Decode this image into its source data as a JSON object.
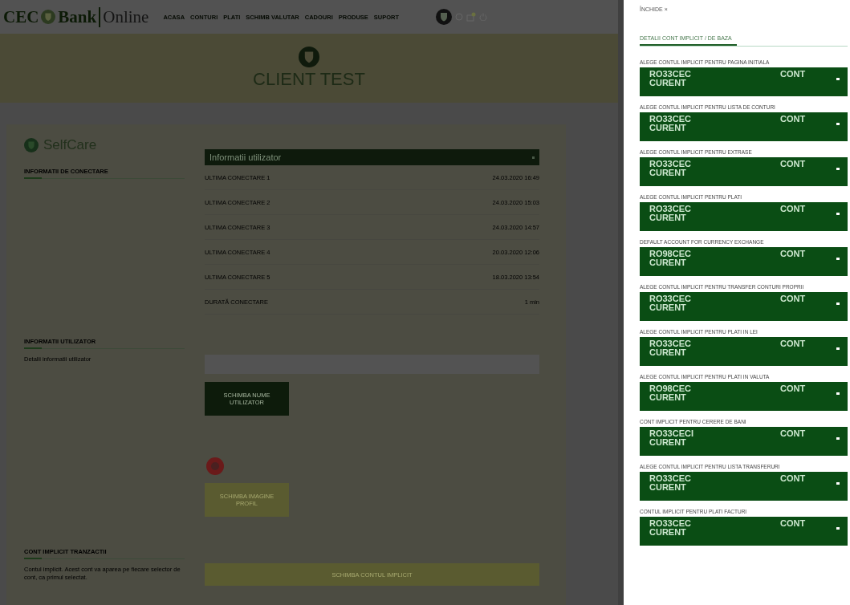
{
  "nav": {
    "logo": {
      "left": "CEC",
      "middle": "Bank",
      "right": "Online"
    },
    "items": [
      "ACASA",
      "CONTURI",
      "PLATI",
      "SCHIMB VALUTAR",
      "CADOURI",
      "PRODUSE",
      "SUPORT"
    ]
  },
  "header": {
    "client_name": "CLIENT TEST"
  },
  "selfcare": {
    "title": "SelfCare",
    "sections": [
      {
        "title": "INFORMATII DE CONECTARE"
      },
      {
        "title": "INFORMATII UTILIZATOR",
        "text": "Detalii informatii utilizator"
      },
      {
        "title": "CONT IMPLICIT TRANZACTII",
        "text": "Contul implicit. Acest cont va aparea pe fiecare selector de cont, ca primul selectat."
      }
    ],
    "dropdown": {
      "value": "Informatii utilizator"
    },
    "rows": [
      {
        "label": "ULTIMA CONECTARE 1",
        "value": "24.03.2020 16:49"
      },
      {
        "label": "ULTIMA CONECTARE 2",
        "value": "24.03.2020 15:03"
      },
      {
        "label": "ULTIMA CONECTARE 3",
        "value": "24.03.2020 14:57"
      },
      {
        "label": "ULTIMA CONECTARE 4",
        "value": "20.03.2020 12:06"
      },
      {
        "label": "ULTIMA CONECTARE 5",
        "value": "18.03.2020 13:54"
      },
      {
        "label": "DURATĂ CONECTARE",
        "value": "1 min"
      }
    ],
    "buttons": [
      {
        "label": "SCHIMBA NUME UTILIZATOR",
        "disabled": false
      },
      {
        "label": "SCHIMBA IMAGINE PROFIL",
        "disabled": true
      },
      {
        "label": "SCHIMBA CONTUL IMPLICIT",
        "disabled": true
      }
    ]
  },
  "drawer": {
    "close": "ÎNCHIDE ×",
    "tabs": [
      {
        "label": "DETALII CONT IMPLICIT / DE BAZA",
        "selected": true
      }
    ],
    "selects": [
      {
        "label": "ALEGE CONTUL IMPLICIT PENTRU PAGINA INITIALA",
        "account": "RO33CEC",
        "type": "CURENT",
        "kind_label": "CONT"
      },
      {
        "label": "ALEGE CONTUL IMPLICIT PENTRU LISTA DE CONTURI",
        "account": "RO33CEC",
        "type": "CURENT",
        "kind_label": "CONT"
      },
      {
        "label": "ALEGE CONTUL IMPLICIT PENTRU EXTRASE",
        "account": "RO33CEC",
        "type": "CURENT",
        "kind_label": "CONT"
      },
      {
        "label": "ALEGE CONTUL IMPLICIT PENTRU PLATI",
        "account": "RO33CEC",
        "type": "CURENT",
        "kind_label": "CONT"
      },
      {
        "label": "DEFAULT ACCOUNT FOR CURRENCY EXCHANGE",
        "account": "RO98CEC",
        "type": "CURENT",
        "kind_label": "CONT"
      },
      {
        "label": "ALEGE CONTUL IMPLICIT PENTRU TRANSFER CONTURI PROPRII",
        "account": "RO33CEC",
        "type": "CURENT",
        "kind_label": "CONT"
      },
      {
        "label": "ALEGE CONTUL IMPLICIT PENTRU PLATI IN LEI",
        "account": "RO33CEC",
        "type": "CURENT",
        "kind_label": "CONT"
      },
      {
        "label": "ALEGE CONTUL IMPLICIT PENTRU PLATI IN VALUTA",
        "account": "RO98CEC",
        "type": "CURENT",
        "kind_label": "CONT"
      },
      {
        "label": "CONT IMPLICIT PENTRU CERERE DE BANI",
        "account": "RO33CECI",
        "type": "CURENT",
        "kind_label": "CONT"
      },
      {
        "label": "ALEGE CONTUL IMPLICIT PENTRU LISTA TRANSFERURI",
        "account": "RO33CEC",
        "type": "CURENT",
        "kind_label": "CONT"
      },
      {
        "label": "CONTUL IMPLICIT PENTRU PLATI FACTURI",
        "account": "RO33CEC",
        "type": "CURENT",
        "kind_label": "CONT"
      }
    ]
  }
}
